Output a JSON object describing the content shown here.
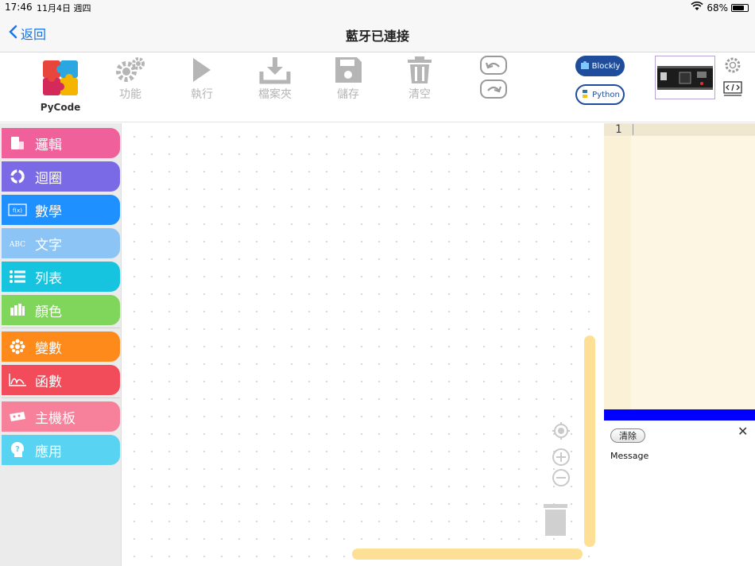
{
  "status_bar": {
    "time": "17:46",
    "date": "11月4日 週四",
    "battery": "68%",
    "battery_level": 0.68
  },
  "nav": {
    "back_label": "返回",
    "title": "藍牙已連接"
  },
  "logo": {
    "name": "PyCode"
  },
  "toolbar": {
    "function_label": "功能",
    "run_label": "執行",
    "folder_label": "檔案夾",
    "save_label": "儲存",
    "clear_label": "清空",
    "blockly_label": "Blockly",
    "python_label": "Python"
  },
  "categories": [
    {
      "label": "邏輯",
      "color": "#f0609a"
    },
    {
      "label": "迴圈",
      "color": "#7b6ae6"
    },
    {
      "label": "數學",
      "color": "#1e90ff"
    },
    {
      "label": "文字",
      "color": "#8cc4f5"
    },
    {
      "label": "列表",
      "color": "#17c4e0"
    },
    {
      "label": "顏色",
      "color": "#7fd65a"
    },
    {
      "label": "變數",
      "color": "#ff8a1c"
    },
    {
      "label": "函數",
      "color": "#f24b5a"
    },
    {
      "label": "主機板",
      "color": "#f7809a"
    },
    {
      "label": "應用",
      "color": "#58d3f2"
    }
  ],
  "editor": {
    "line_number": "1"
  },
  "console": {
    "clear_label": "清除",
    "message": "Message"
  },
  "colors": {
    "accent": "#1a73e8",
    "scrollbar": "#fddf96",
    "console_bar": "#0000ff",
    "editor_bg": "#fdf6e3"
  }
}
